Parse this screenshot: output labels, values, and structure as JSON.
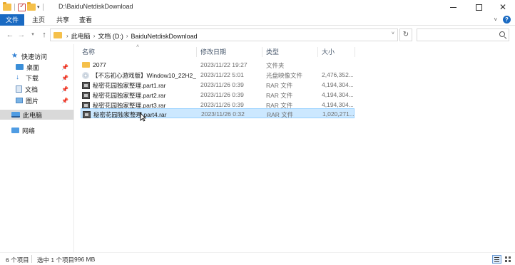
{
  "window": {
    "title": "D:\\BaiduNetdiskDownload",
    "minimize": "minimize",
    "maximize": "maximize",
    "close": "close"
  },
  "ribbon": {
    "tabs": [
      "文件",
      "主页",
      "共享",
      "查看"
    ]
  },
  "nav": {
    "breadcrumbs": [
      "此电脑",
      "文档 (D:)",
      "BaiduNetdiskDownload"
    ],
    "search_placeholder": ""
  },
  "sidebar": {
    "quick_access": "快速访问",
    "items": [
      {
        "label": "桌面",
        "icon": "desktop-icon",
        "pinned": true
      },
      {
        "label": "下载",
        "icon": "download-icon",
        "pinned": true
      },
      {
        "label": "文档",
        "icon": "documents-icon",
        "pinned": true
      },
      {
        "label": "图片",
        "icon": "pictures-icon",
        "pinned": true
      }
    ],
    "this_pc": "此电脑",
    "network": "网络"
  },
  "file_list": {
    "columns": [
      "名称",
      "修改日期",
      "类型",
      "大小"
    ],
    "rows": [
      {
        "name": "2077",
        "date": "2023/11/22 19:27",
        "type": "文件夹",
        "size": "",
        "icon": "folder-icon",
        "selected": false
      },
      {
        "name": "【不忘初心游戏版】Window10_22H2_1...",
        "date": "2023/11/22 5:01",
        "type": "光盘映像文件",
        "size": "2,476,352...",
        "icon": "iso-icon",
        "selected": false
      },
      {
        "name": "秘密花园独家整理.part1.rar",
        "date": "2023/11/26 0:39",
        "type": "RAR 文件",
        "size": "4,194,304...",
        "icon": "rar-icon",
        "selected": false
      },
      {
        "name": "秘密花园独家整理.part2.rar",
        "date": "2023/11/26 0:39",
        "type": "RAR 文件",
        "size": "4,194,304...",
        "icon": "rar-icon",
        "selected": false
      },
      {
        "name": "秘密花园独家整理.part3.rar",
        "date": "2023/11/26 0:39",
        "type": "RAR 文件",
        "size": "4,194,304...",
        "icon": "rar-icon",
        "selected": false
      },
      {
        "name": "秘密花园独家整理.part4.rar",
        "date": "2023/11/26 0:32",
        "type": "RAR 文件",
        "size": "1,020,271...",
        "icon": "rar-icon",
        "selected": true
      }
    ]
  },
  "status": {
    "item_count": "6 个项目",
    "selected": "选中 1 个项目",
    "selected_size": "996 MB"
  },
  "colors": {
    "accent": "#1a6ac2",
    "selection_bg": "#cce8ff",
    "selection_border": "#99d1ff"
  }
}
